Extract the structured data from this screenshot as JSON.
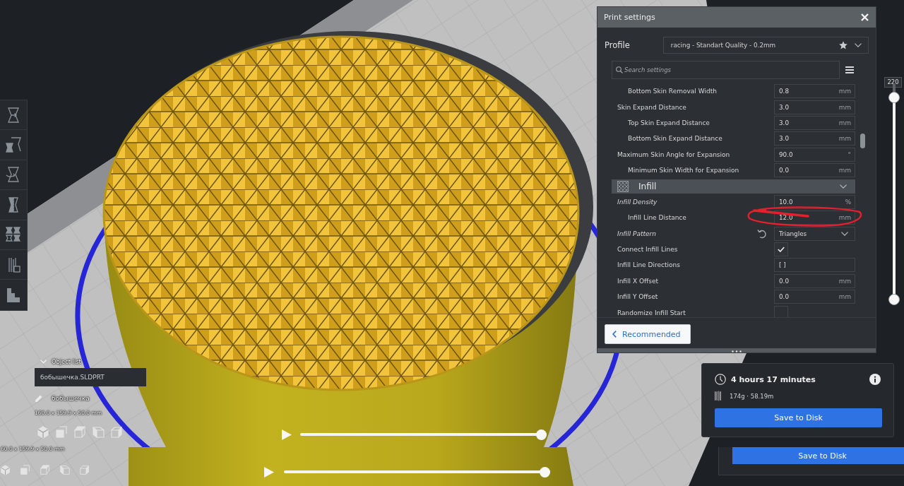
{
  "print_settings": {
    "title": "Print settings",
    "profile_label": "Profile",
    "profile": "racing - Standart Quality - 0.2mm",
    "search_placeholder": "Search settings",
    "settings": [
      {
        "kind": "group",
        "children": [
          {
            "kind": "number",
            "label": "Bottom Skin Removal Width",
            "value": "0.8",
            "unit": "mm",
            "in_profile": false,
            "resettable": false
          }
        ]
      },
      {
        "kind": "number",
        "label": "Skin Expand Distance",
        "value": "3.0",
        "unit": "mm",
        "in_profile": false,
        "resettable": false,
        "children": [
          {
            "kind": "number",
            "label": "Top Skin Expand Distance",
            "value": "3.0",
            "unit": "mm",
            "in_profile": false,
            "resettable": false
          },
          {
            "kind": "number",
            "label": "Bottom Skin Expand Distance",
            "value": "3.0",
            "unit": "mm",
            "in_profile": false,
            "resettable": false
          }
        ]
      },
      {
        "kind": "number",
        "label": "Maximum Skin Angle for Expansion",
        "value": "90.0",
        "unit": "°",
        "in_profile": false,
        "resettable": false,
        "children": [
          {
            "kind": "number",
            "label": "Minimum Skin Width for Expansion",
            "value": "0.0",
            "unit": "mm",
            "in_profile": false,
            "resettable": false
          }
        ]
      },
      {
        "kind": "section",
        "label": "Infill",
        "expanded": true,
        "children": [
          {
            "kind": "number",
            "label": "Infill Density",
            "value": "10.0",
            "unit": "%",
            "in_profile": true,
            "resettable": false,
            "children": [
              {
                "kind": "number",
                "label": "Infill Line Distance",
                "value": "12.0",
                "unit": "mm",
                "in_profile": false,
                "resettable": false
              }
            ]
          },
          {
            "kind": "dropdown",
            "label": "Infill Pattern",
            "value": "Triangles",
            "in_profile": true,
            "resettable": true
          },
          {
            "kind": "checkbox",
            "label": "Connect Infill Lines",
            "checked": true,
            "in_profile": false,
            "resettable": false
          },
          {
            "kind": "text",
            "label": "Infill Line Directions",
            "value": "[ ]",
            "in_profile": false,
            "resettable": false
          },
          {
            "kind": "number",
            "label": "Infill X Offset",
            "value": "0.0",
            "unit": "mm",
            "in_profile": false,
            "resettable": false
          },
          {
            "kind": "number",
            "label": "Infill Y Offset",
            "value": "0.0",
            "unit": "mm",
            "in_profile": false,
            "resettable": false
          },
          {
            "kind": "checkbox",
            "label": "Randomize Infill Start",
            "checked": false,
            "in_profile": false,
            "resettable": false
          }
        ]
      }
    ],
    "footer_button": "Recommended"
  },
  "layer_slider": {
    "reading": "220",
    "handles": [
      {
        "level": 0.96
      },
      {
        "level": 0
      }
    ]
  },
  "object_list": {
    "title": "Object list",
    "expanded": true,
    "items": [
      {
        "name": "бобышечка.SLDPRT",
        "selected": true
      }
    ],
    "object_name": "бобышечка",
    "dimensions": "160.0 x 159.9 x 50.0 mm"
  },
  "simulation": {
    "level": 1
  },
  "print_info": {
    "time": "4 hours 17 minutes",
    "material": "174g · 58.19m",
    "button": "Save to Disk"
  },
  "lower_strip": {
    "dimensions": "60.0 x 159.9 x 50.0 mm",
    "simulation": {
      "level": 1
    },
    "button": "Save to Disk"
  }
}
